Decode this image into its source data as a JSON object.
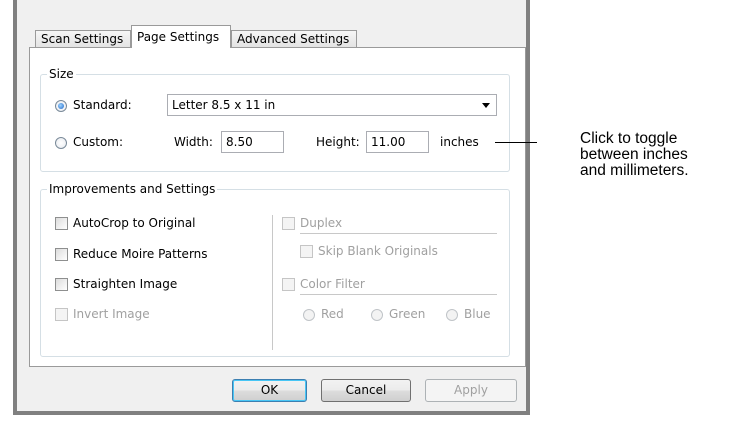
{
  "tabs": [
    "Scan Settings",
    "Page Settings",
    "Advanced Settings"
  ],
  "size_group": {
    "legend": "Size",
    "standard_label": "Standard:",
    "standard_value": "Letter 8.5 x 11 in",
    "custom_label": "Custom:",
    "width_label": "Width:",
    "width_value": "8.50",
    "height_label": "Height:",
    "height_value": "11.00",
    "units_button": "inches"
  },
  "improvements_group": {
    "legend": "Improvements and Settings",
    "autocrop": "AutoCrop to Original",
    "moire": "Reduce Moire Patterns",
    "straighten": "Straighten Image",
    "invert": "Invert Image",
    "duplex": "Duplex",
    "skip_blank": "Skip Blank Originals",
    "color_filter": "Color Filter",
    "red": "Red",
    "green": "Green",
    "blue": "Blue"
  },
  "buttons": {
    "ok": "OK",
    "cancel": "Cancel",
    "apply": "Apply"
  },
  "callout": {
    "line1": "Click to toggle",
    "line2": "between inches",
    "line3": "and millimeters."
  },
  "colors": {
    "accent": "#1b64c7",
    "panel_bg": "#ffffff",
    "dialog_bg": "#f0f0f0"
  }
}
